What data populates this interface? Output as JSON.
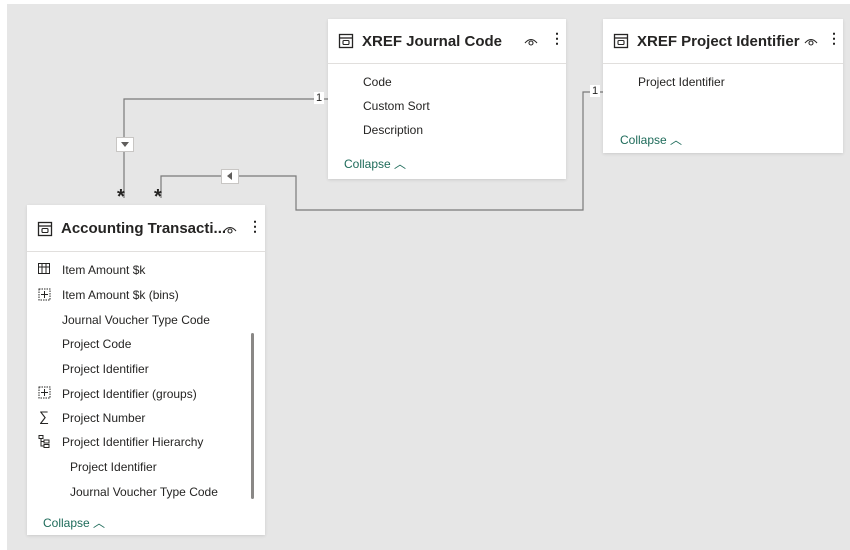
{
  "tables": {
    "journal": {
      "title": "XREF Journal Code",
      "fields": [
        "Code",
        "Custom Sort",
        "Description"
      ],
      "collapse_label": "Collapse"
    },
    "project": {
      "title": "XREF Project Identifier",
      "fields": [
        "Project Identifier"
      ],
      "collapse_label": "Collapse"
    },
    "accounting": {
      "title": "Accounting Transacti...",
      "fields": [
        {
          "label": "Item Amount $k",
          "icon": "calculated-table-icon"
        },
        {
          "label": "Item Amount $k (bins)",
          "icon": "bins-icon"
        },
        {
          "label": "Journal Voucher Type Code",
          "icon": ""
        },
        {
          "label": "Project Code",
          "icon": ""
        },
        {
          "label": "Project Identifier",
          "icon": ""
        },
        {
          "label": "Project Identifier (groups)",
          "icon": "groups-icon"
        },
        {
          "label": "Project Number",
          "icon": "sum-icon"
        },
        {
          "label": "Project Identifier Hierarchy",
          "icon": "hierarchy-icon"
        },
        {
          "label": "Project Identifier",
          "icon": ""
        },
        {
          "label": "Journal Voucher Type Code",
          "icon": ""
        }
      ],
      "collapse_label": "Collapse"
    }
  },
  "relationships": [
    {
      "from": "accounting",
      "to": "journal",
      "from_cardinality": "*",
      "to_cardinality": "1",
      "direction": "down"
    },
    {
      "from": "accounting",
      "to": "project",
      "from_cardinality": "*",
      "to_cardinality": "1",
      "direction": "left"
    }
  ],
  "colors": {
    "canvas": "#e6e6e6",
    "card": "#ffffff",
    "collapse_link": "#1e6b5a",
    "connector": "#7a7a7a"
  }
}
